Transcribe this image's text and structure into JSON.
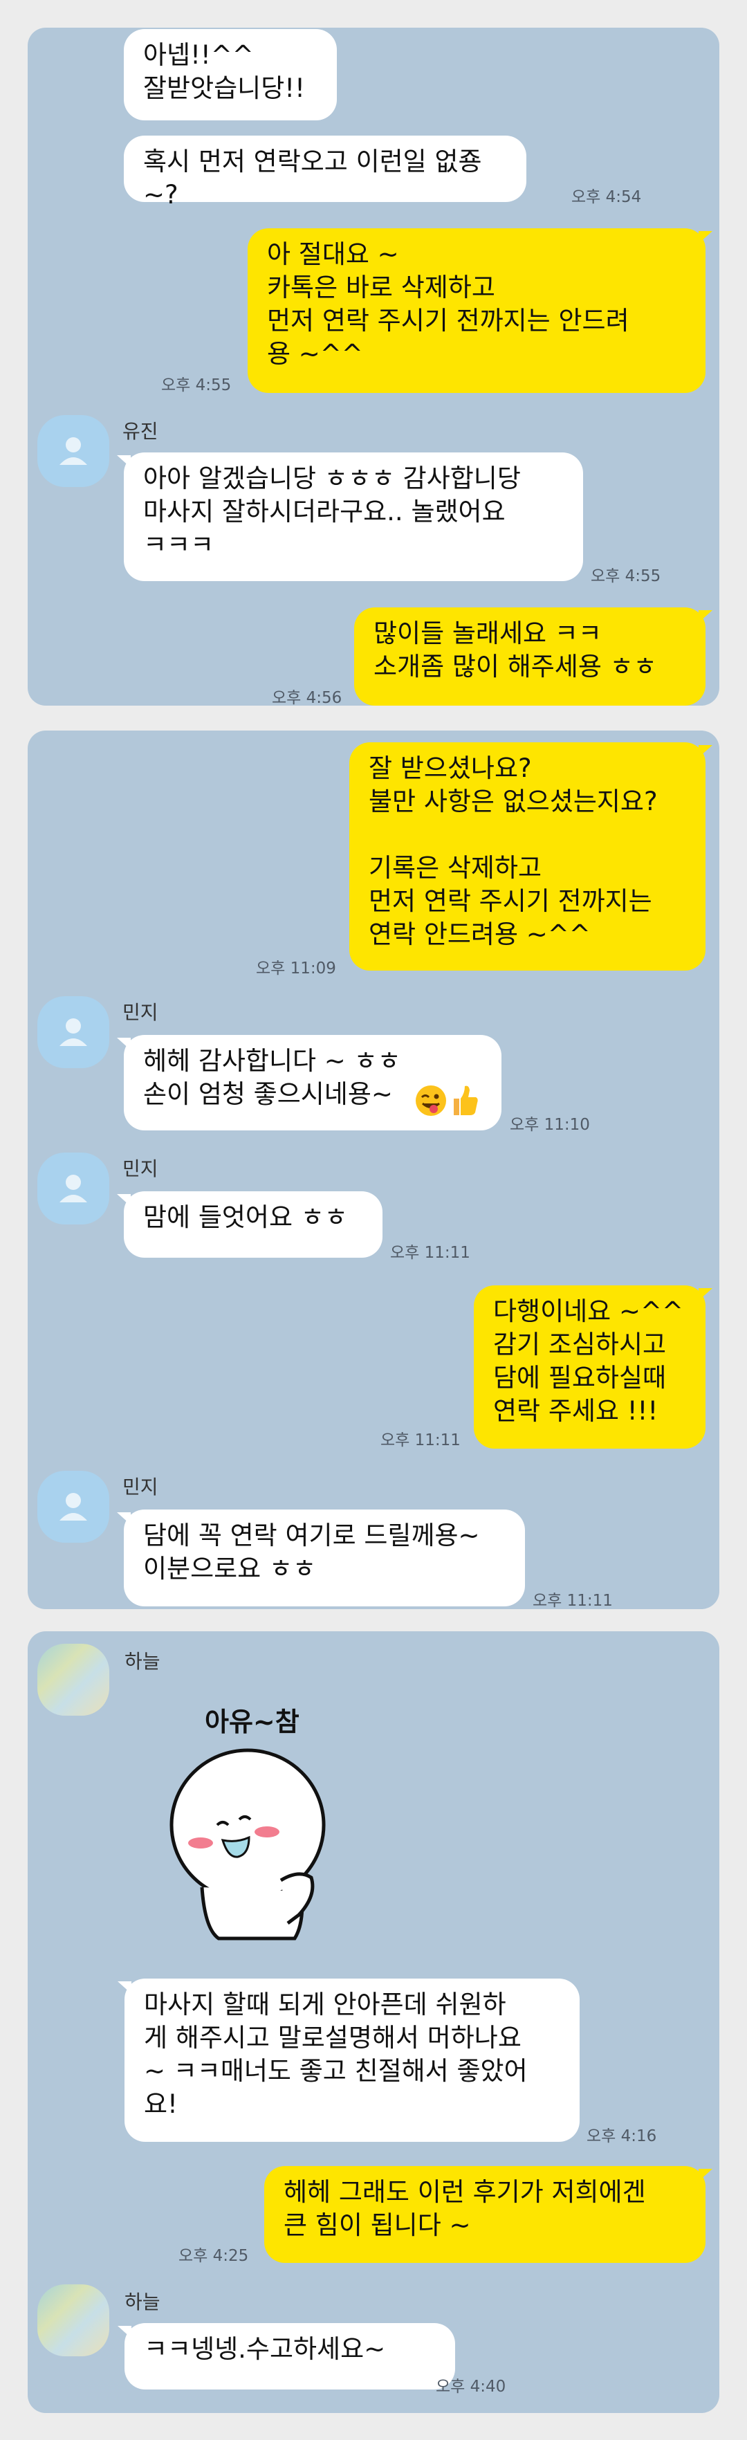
{
  "panels": [
    {
      "messages": [
        {
          "text": "아넵!!^^\n잘받앗습니당!!"
        },
        {
          "text": "혹시 먼저 연락오고 이런일 없죵~?",
          "time": "오후 4:54"
        },
        {
          "text": "아 절대요 ~\n카톡은 바로 삭제하고\n먼저 연락 주시기 전까지는 안드려\n용 ~^^",
          "time": "오후 4:55"
        },
        {
          "sender": "유진",
          "text": "아아 알겠습니당 ㅎㅎㅎ 감사합니당\n마사지 잘하시더라구요.. 놀랬어요\nㅋㅋㅋ",
          "time": "오후 4:55"
        },
        {
          "text": "많이들 놀래세요 ㅋㅋ\n소개좀 많이 해주세용 ㅎㅎ",
          "time": "오후 4:56"
        }
      ]
    },
    {
      "messages": [
        {
          "text": "잘 받으셨나요?\n불만 사항은 없으셨는지요?\n\n기록은 삭제하고\n먼저 연락 주시기 전까지는\n연락 안드려용 ~^^",
          "time": "오후 11:09"
        },
        {
          "sender": "민지",
          "text": "헤헤 감사합니다 ~ ㅎㅎ\n손이 엄청 좋으시네용~",
          "time": "오후 11:10",
          "emojis": [
            "tongue-wink-emoji",
            "thumbs-up-emoji"
          ]
        },
        {
          "sender": "민지",
          "text": "맘에 들엇어요 ㅎㅎ",
          "time": "오후 11:11"
        },
        {
          "text": "다행이네요 ~^^\n감기 조심하시고\n담에 필요하실때\n연락 주세요 !!!",
          "time": "오후 11:11"
        },
        {
          "sender": "민지",
          "text": "담에 꼭 연락 여기로 드릴께용~\n이분으로요 ㅎㅎ",
          "time": "오후 11:11"
        }
      ]
    },
    {
      "messages": [
        {
          "sender": "하늘",
          "sticker_text": "아유~참"
        },
        {
          "text": "마사지 할때 되게 안아픈데 쉬원하\n게 해주시고 말로설명해서 머하나요\n~ ㅋㅋ매너도 좋고 친절해서 좋았어\n요!",
          "time": "오후 4:16"
        },
        {
          "text": "헤헤 그래도 이런 후기가 저희에겐\n큰 힘이 됩니다 ~",
          "time": "오후 4:25"
        },
        {
          "sender": "하늘",
          "text": "ㅋㅋ넹넹.수고하세요~",
          "time": "오후 4:40"
        }
      ]
    }
  ],
  "colors": {
    "background": "#b2c7d9",
    "outgoing_bubble": "#fee500",
    "incoming_bubble": "#ffffff",
    "timestamp": "#505a66"
  }
}
